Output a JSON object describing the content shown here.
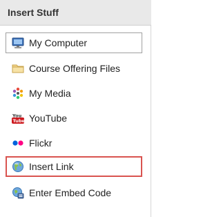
{
  "panel": {
    "title": "Insert Stuff"
  },
  "items": [
    {
      "label": "My Computer",
      "icon": "monitor-icon"
    },
    {
      "label": "Course Offering Files",
      "icon": "folder-icon"
    },
    {
      "label": "My Media",
      "icon": "media-icon"
    },
    {
      "label": "YouTube",
      "icon": "youtube-icon"
    },
    {
      "label": "Flickr",
      "icon": "flickr-icon"
    },
    {
      "label": "Insert Link",
      "icon": "globe-icon"
    },
    {
      "label": "Enter Embed Code",
      "icon": "embed-globe-icon"
    }
  ],
  "colors": {
    "highlight_border": "#d9534f",
    "header_bg": "#e9e9e9",
    "flickr_blue": "#0063dc",
    "flickr_pink": "#ff0084",
    "youtube_red": "#cc181e"
  }
}
